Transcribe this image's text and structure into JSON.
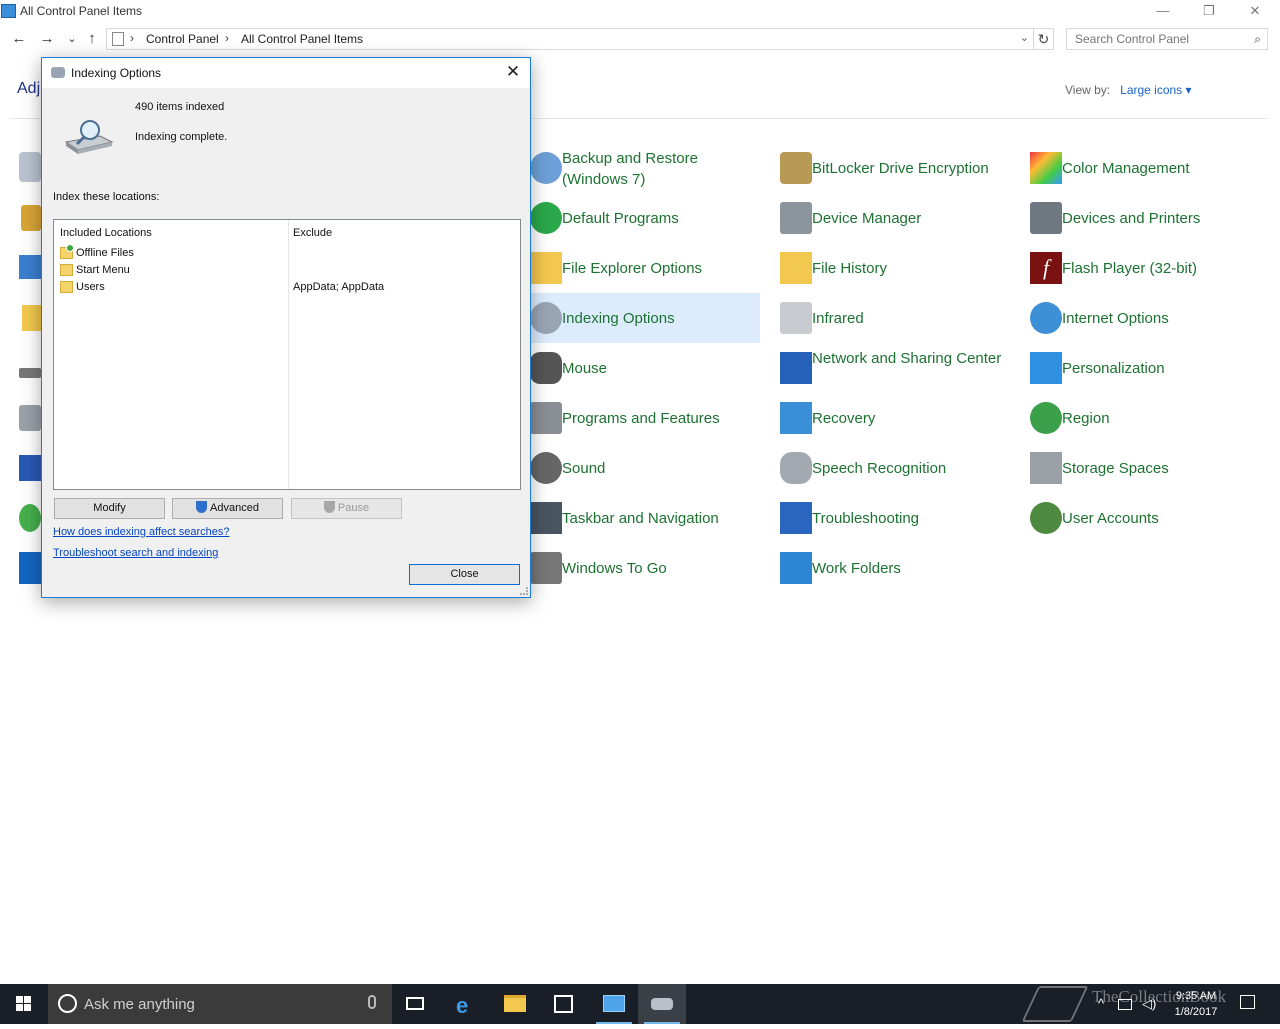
{
  "window": {
    "title": "All Control Panel Items",
    "minimize_glyph": "—",
    "restore_glyph": "❐",
    "close_glyph": "✕"
  },
  "addressbar": {
    "back_glyph": "←",
    "forward_glyph": "→",
    "recent_glyph": "⌄",
    "up_glyph": "↑",
    "crumbs": [
      "Control Panel",
      "All Control Panel Items"
    ],
    "separator": "›",
    "refresh_glyph": "↻",
    "search_placeholder": "Search Control Panel"
  },
  "header": {
    "heading_fragment": "Adj",
    "view_by_label": "View by:",
    "view_by_value": "Large icons ▾"
  },
  "items": [
    {
      "label": "Backup and Restore (Windows 7)",
      "icon": "backup-restore-icon"
    },
    {
      "label": "BitLocker Drive Encryption",
      "icon": "bitlocker-icon"
    },
    {
      "label": "Color Management",
      "icon": "color-management-icon"
    },
    {
      "label": "Default Programs",
      "icon": "default-programs-icon"
    },
    {
      "label": "Device Manager",
      "icon": "device-manager-icon"
    },
    {
      "label": "Devices and Printers",
      "icon": "devices-printers-icon"
    },
    {
      "label": "File Explorer Options",
      "icon": "file-explorer-options-icon"
    },
    {
      "label": "File History",
      "icon": "file-history-icon"
    },
    {
      "label": "Flash Player (32-bit)",
      "icon": "flash-player-icon"
    },
    {
      "label": "Indexing Options",
      "icon": "indexing-options-icon"
    },
    {
      "label": "Infrared",
      "icon": "infrared-icon"
    },
    {
      "label": "Internet Options",
      "icon": "internet-options-icon"
    },
    {
      "label": "Mouse",
      "icon": "mouse-icon"
    },
    {
      "label": "Network and Sharing Center",
      "icon": "network-sharing-icon"
    },
    {
      "label": "Personalization",
      "icon": "personalization-icon"
    },
    {
      "label": "Programs and Features",
      "icon": "programs-features-icon"
    },
    {
      "label": "Recovery",
      "icon": "recovery-icon"
    },
    {
      "label": "Region",
      "icon": "region-icon"
    },
    {
      "label": "Sound",
      "icon": "sound-icon"
    },
    {
      "label": "Speech Recognition",
      "icon": "speech-recognition-icon"
    },
    {
      "label": "Storage Spaces",
      "icon": "storage-spaces-icon"
    },
    {
      "label": "Taskbar and Navigation",
      "icon": "taskbar-navigation-icon"
    },
    {
      "label": "Troubleshooting",
      "icon": "troubleshooting-icon"
    },
    {
      "label": "User Accounts",
      "icon": "user-accounts-icon"
    },
    {
      "label": "Windows To Go",
      "icon": "windows-to-go-icon"
    },
    {
      "label": "Work Folders",
      "icon": "work-folders-icon"
    }
  ],
  "dialog": {
    "title": "Indexing Options",
    "close_glyph": "✕",
    "items_indexed": "490 items indexed",
    "status": "Indexing complete.",
    "index_label": "Index these locations:",
    "col_included": "Included Locations",
    "col_exclude": "Exclude",
    "locations": [
      {
        "name": "Offline Files",
        "exclude": ""
      },
      {
        "name": "Start Menu",
        "exclude": ""
      },
      {
        "name": "Users",
        "exclude": "AppData; AppData"
      }
    ],
    "modify_label": "Modify",
    "advanced_label": "Advanced",
    "pause_label": "Pause",
    "link_affect": "How does indexing affect searches?",
    "link_troubleshoot": "Troubleshoot search and indexing",
    "close_label": "Close"
  },
  "taskbar": {
    "search_text": "Ask me anything",
    "clock_time": "9:35 AM",
    "clock_date": "1/8/2017",
    "watermark": "TheCollectionBook",
    "apps": [
      "task-view-icon",
      "edge-icon",
      "file-explorer-icon",
      "store-icon",
      "control-panel-icon",
      "indexing-options-icon"
    ]
  },
  "colors": {
    "link_green": "#1d7232",
    "accent_blue": "#1b7bd8",
    "selected_bg": "#dcecfc"
  }
}
